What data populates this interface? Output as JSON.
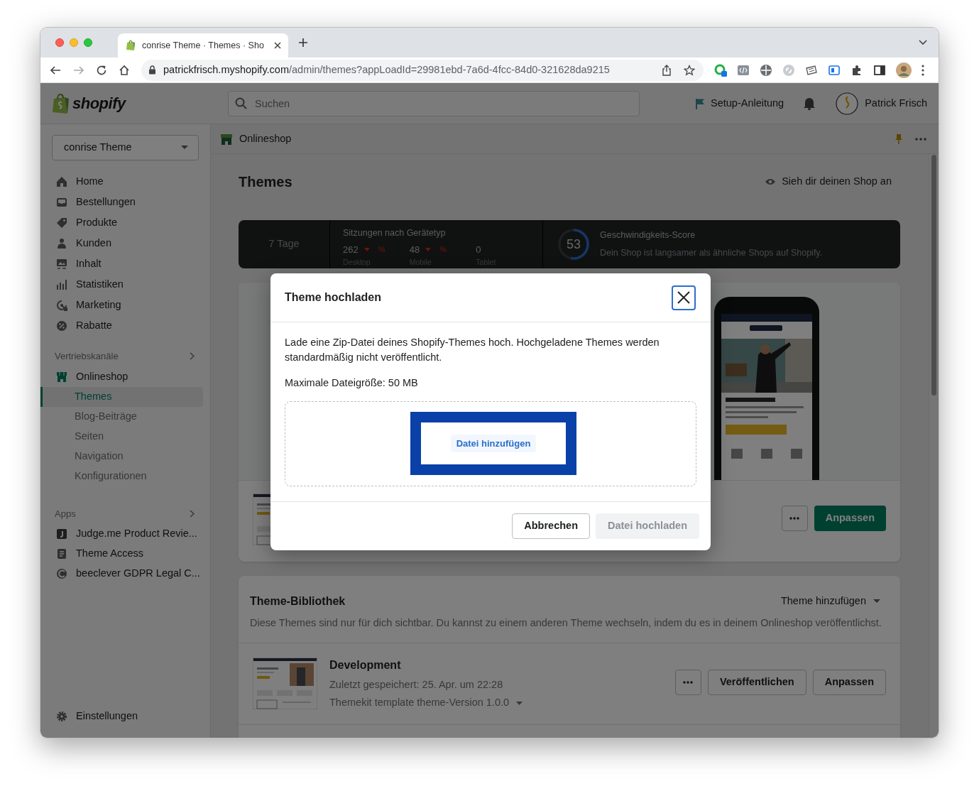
{
  "browser": {
    "tab": {
      "title": "conrise Theme · Themes · Sho"
    },
    "url": {
      "host": "patrickfrisch.myshopify.com",
      "path": "/admin/themes?appLoadId=29981ebd-7a6d-4fcc-84d0-321628da9215"
    }
  },
  "topbar": {
    "logo": "shopify",
    "search": {
      "placeholder": "Suchen"
    },
    "setup_guide": "Setup-Anleitung",
    "user": "Patrick Frisch"
  },
  "sidebar": {
    "store_select": "conrise Theme",
    "items": [
      {
        "label": "Home"
      },
      {
        "label": "Bestellungen"
      },
      {
        "label": "Produkte"
      },
      {
        "label": "Kunden"
      },
      {
        "label": "Inhalt"
      },
      {
        "label": "Statistiken"
      },
      {
        "label": "Marketing"
      },
      {
        "label": "Rabatte"
      }
    ],
    "sales_channels": {
      "heading": "Vertriebskanäle",
      "channel": "Onlineshop",
      "children": [
        {
          "label": "Themes",
          "selected": true
        },
        {
          "label": "Blog-Beiträge",
          "selected": false
        },
        {
          "label": "Seiten",
          "selected": false
        },
        {
          "label": "Navigation",
          "selected": false
        },
        {
          "label": "Konfigurationen",
          "selected": false
        }
      ]
    },
    "apps": {
      "heading": "Apps",
      "items": [
        {
          "label": "Judge.me Product Revie..."
        },
        {
          "label": "Theme Access"
        },
        {
          "label": "beeclever GDPR Legal C..."
        }
      ]
    },
    "settings": "Einstellungen"
  },
  "breadcrumb": "Onlineshop",
  "page": {
    "title": "Themes",
    "view_store": "Sieh dir deinen Shop an"
  },
  "stats": {
    "period": "7 Tage",
    "sessions": {
      "title": "Sitzungen nach Gerätetyp",
      "devices": [
        {
          "value": "262",
          "label": "Desktop",
          "falling": true,
          "change": "%"
        },
        {
          "value": "48",
          "label": "Mobile",
          "falling": true,
          "change": "%"
        },
        {
          "value": "0",
          "label": "Tablet"
        }
      ]
    },
    "speed": {
      "score": "53",
      "level": 0.53,
      "title": "Geschwindigkeits-Score",
      "text": "Dein Shop ist langsamer als ähnliche Shops auf Shopify."
    }
  },
  "current_theme": {
    "customize": "Anpassen"
  },
  "library": {
    "title": "Theme-Bibliothek",
    "add_theme": "Theme hinzufügen",
    "description": "Diese Themes sind nur für dich sichtbar. Du kannst zu einem anderen Theme wechseln, indem du es in deinem Onlineshop veröffentlichst.",
    "themes": [
      {
        "name": "Development",
        "saved": "Zuletzt gespeichert: 25. Apr. um 22:28",
        "version": "Themekit template theme-Version 1.0.0",
        "publish": "Veröffentlichen",
        "customize": "Anpassen"
      }
    ]
  },
  "modal": {
    "title": "Theme hochladen",
    "text": "Lade eine Zip-Datei deines Shopify-Themes hoch. Hochgeladene Themes werden standardmäßig nicht veröffentlicht.",
    "max_size": "Maximale Dateigröße: 50 MB",
    "add_file": "Datei hinzufügen",
    "buttons": [
      {
        "label": "Abbrechen",
        "disabled": false
      },
      {
        "label": "Datei hochladen",
        "disabled": true
      }
    ]
  }
}
